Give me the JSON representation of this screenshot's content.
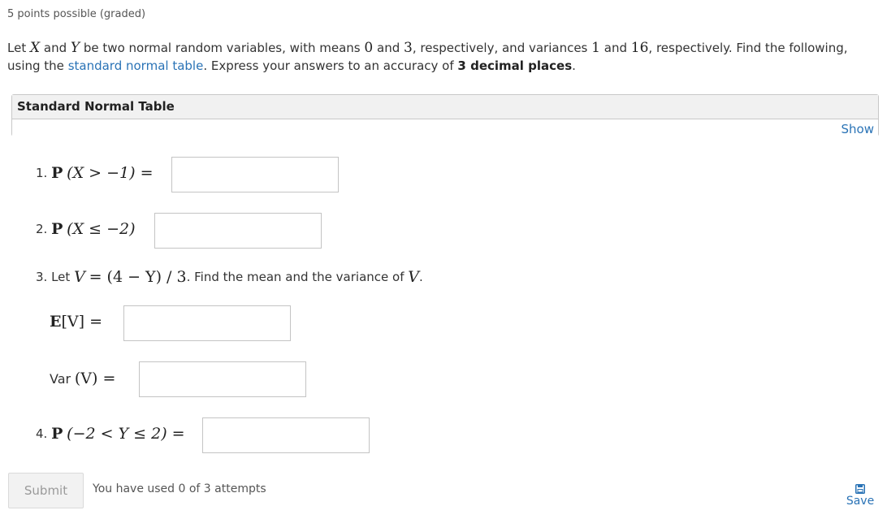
{
  "header": {
    "points": "5 points possible (graded)"
  },
  "problem": {
    "p1": "Let",
    "x": "X",
    "p2": "and",
    "y": "Y",
    "p3": "be two normal random variables, with means",
    "mean_x": "0",
    "p4": "and",
    "mean_y": "3",
    "p5": ", respectively, and variances",
    "var_x": "1",
    "p6": "and",
    "var_y": "16",
    "p7": ", respectively. Find the following, using the",
    "link": "standard normal table",
    "p8": ". Express your answers to an accuracy of",
    "accuracy": "3 decimal places",
    "p9": "."
  },
  "normal_table": {
    "title": "Standard Normal Table",
    "show_label": "Show"
  },
  "questions": {
    "q1": {
      "num": "1.",
      "P": "P",
      "expr": "(X > −1) =",
      "value": ""
    },
    "q2": {
      "num": "2.",
      "P": "P",
      "expr": "(X ≤ −2)",
      "value": ""
    },
    "q3": {
      "num": "3.",
      "text1": "Let",
      "V": "V",
      "eq": "= (4 − Y) / 3",
      "text2": ". Find the mean and the variance of",
      "V2": "V",
      "text3": ".",
      "mean_label_E": "E",
      "mean_label_rest": "[V] =",
      "mean_value": "",
      "var_label": "Var",
      "var_rest": "(V) =",
      "var_value": ""
    },
    "q4": {
      "num": "4.",
      "P": "P",
      "expr": "(−2 < Y ≤ 2) =",
      "value": ""
    }
  },
  "footer": {
    "submit_label": "Submit",
    "attempts": "You have used 0 of 3 attempts",
    "save_label": "Save",
    "save_icon": "save-icon"
  },
  "colors": {
    "link": "#2a73b6",
    "text": "#333333",
    "border": "#c4c4c4"
  }
}
